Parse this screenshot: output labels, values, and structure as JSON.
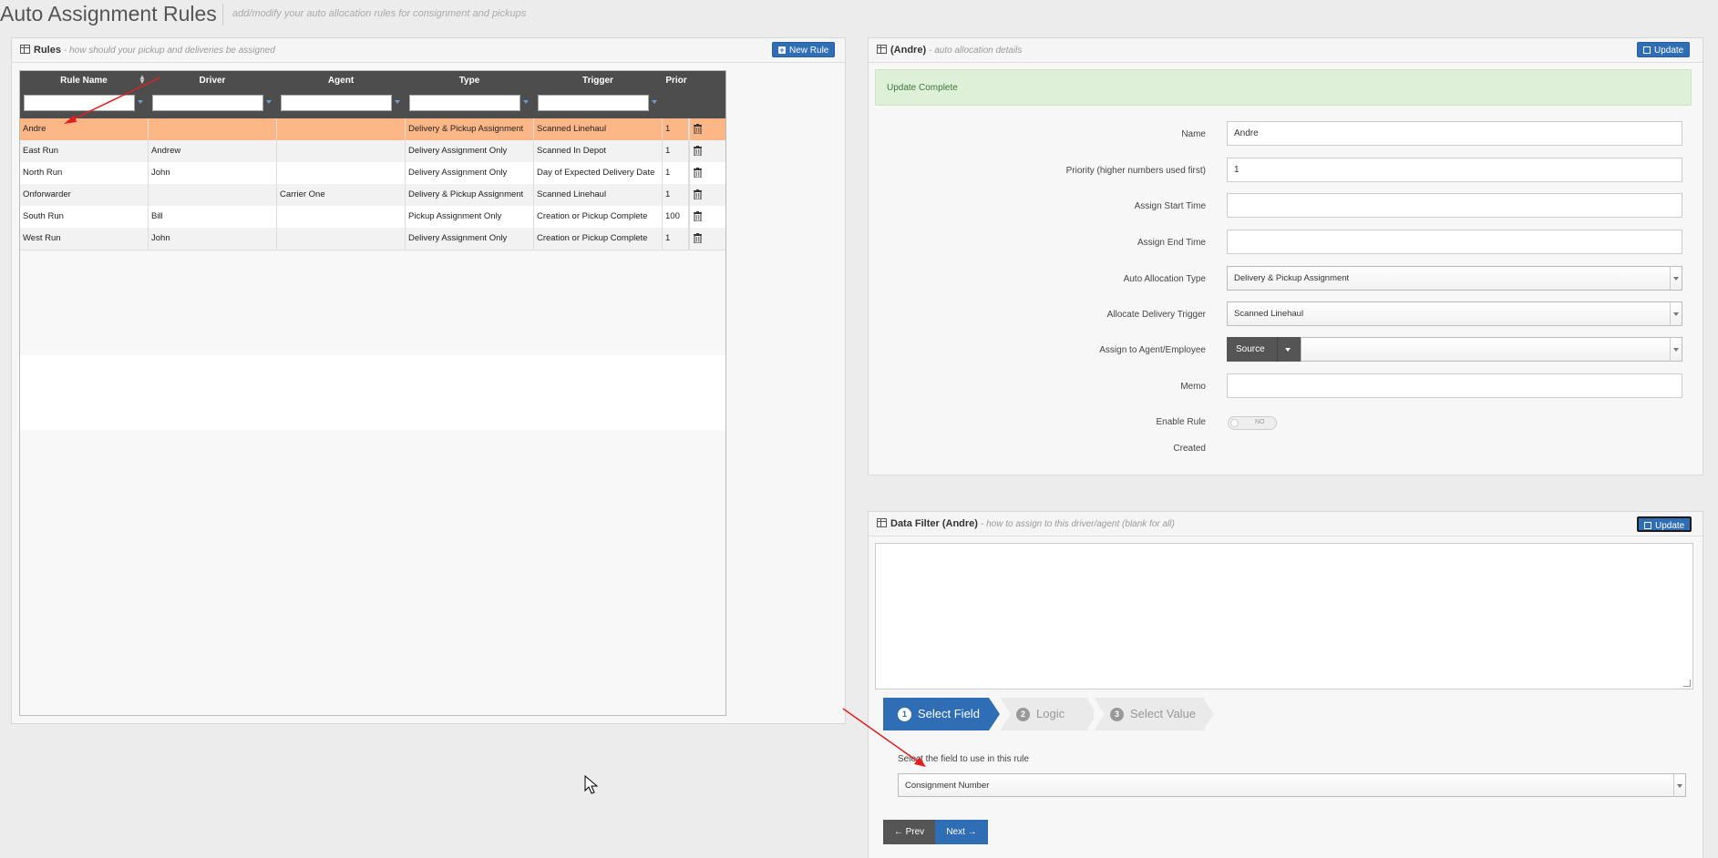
{
  "header": {
    "title": "Auto Assignment Rules",
    "subtitle": "add/modify your auto allocation rules for consignment and pickups"
  },
  "rules_panel": {
    "title": "Rules",
    "subtitle": "- how should your pickup and deliveries be assigned",
    "new_rule_label": "New Rule",
    "columns": [
      "Rule Name",
      "Driver",
      "Agent",
      "Type",
      "Trigger",
      "Prior"
    ],
    "rows": [
      {
        "name": "Andre",
        "driver": "",
        "agent": "",
        "type": "Delivery & Pickup Assignment",
        "trigger": "Scanned Linehaul",
        "priority": "1"
      },
      {
        "name": "East Run",
        "driver": "Andrew",
        "agent": "",
        "type": "Delivery Assignment Only",
        "trigger": "Scanned In Depot",
        "priority": "1"
      },
      {
        "name": "North Run",
        "driver": "John",
        "agent": "",
        "type": "Delivery Assignment Only",
        "trigger": "Day of Expected Delivery Date",
        "priority": "1"
      },
      {
        "name": "Onforwarder",
        "driver": "",
        "agent": "Carrier One",
        "type": "Delivery & Pickup Assignment",
        "trigger": "Scanned Linehaul",
        "priority": "1"
      },
      {
        "name": "South Run",
        "driver": "Bill",
        "agent": "",
        "type": "Pickup Assignment Only",
        "trigger": "Creation or Pickup Complete",
        "priority": "100"
      },
      {
        "name": "West Run",
        "driver": "John",
        "agent": "",
        "type": "Delivery Assignment Only",
        "trigger": "Creation or Pickup Complete",
        "priority": "1"
      }
    ]
  },
  "details_panel": {
    "title": "(Andre)",
    "subtitle": "- auto allocation details",
    "update_label": "Update",
    "alert": "Update Complete",
    "fields": {
      "name_label": "Name",
      "name_value": "Andre",
      "priority_label": "Priority (higher numbers used first)",
      "priority_value": "1",
      "start_label": "Assign Start Time",
      "start_value": "",
      "end_label": "Assign End Time",
      "end_value": "",
      "type_label": "Auto Allocation Type",
      "type_value": "Delivery & Pickup Assignment",
      "trigger_label": "Allocate Delivery Trigger",
      "trigger_value": "Scanned Linehaul",
      "assign_label": "Assign to Agent/Employee",
      "assign_source": "Source",
      "assign_value": "",
      "memo_label": "Memo",
      "memo_value": "",
      "enable_label": "Enable Rule",
      "enable_value": "NO",
      "created_label": "Created"
    }
  },
  "filter_panel": {
    "title": "Data Filter (Andre)",
    "subtitle": "- how to assign to this driver/agent (blank for all)",
    "update_label": "Update",
    "steps": [
      {
        "num": "1",
        "label": "Select Field"
      },
      {
        "num": "2",
        "label": "Logic"
      },
      {
        "num": "3",
        "label": "Select Value"
      }
    ],
    "field_prompt": "Select the field to use in this rule",
    "field_value": "Consignment Number",
    "prev_label": "Prev",
    "next_label": "Next"
  }
}
